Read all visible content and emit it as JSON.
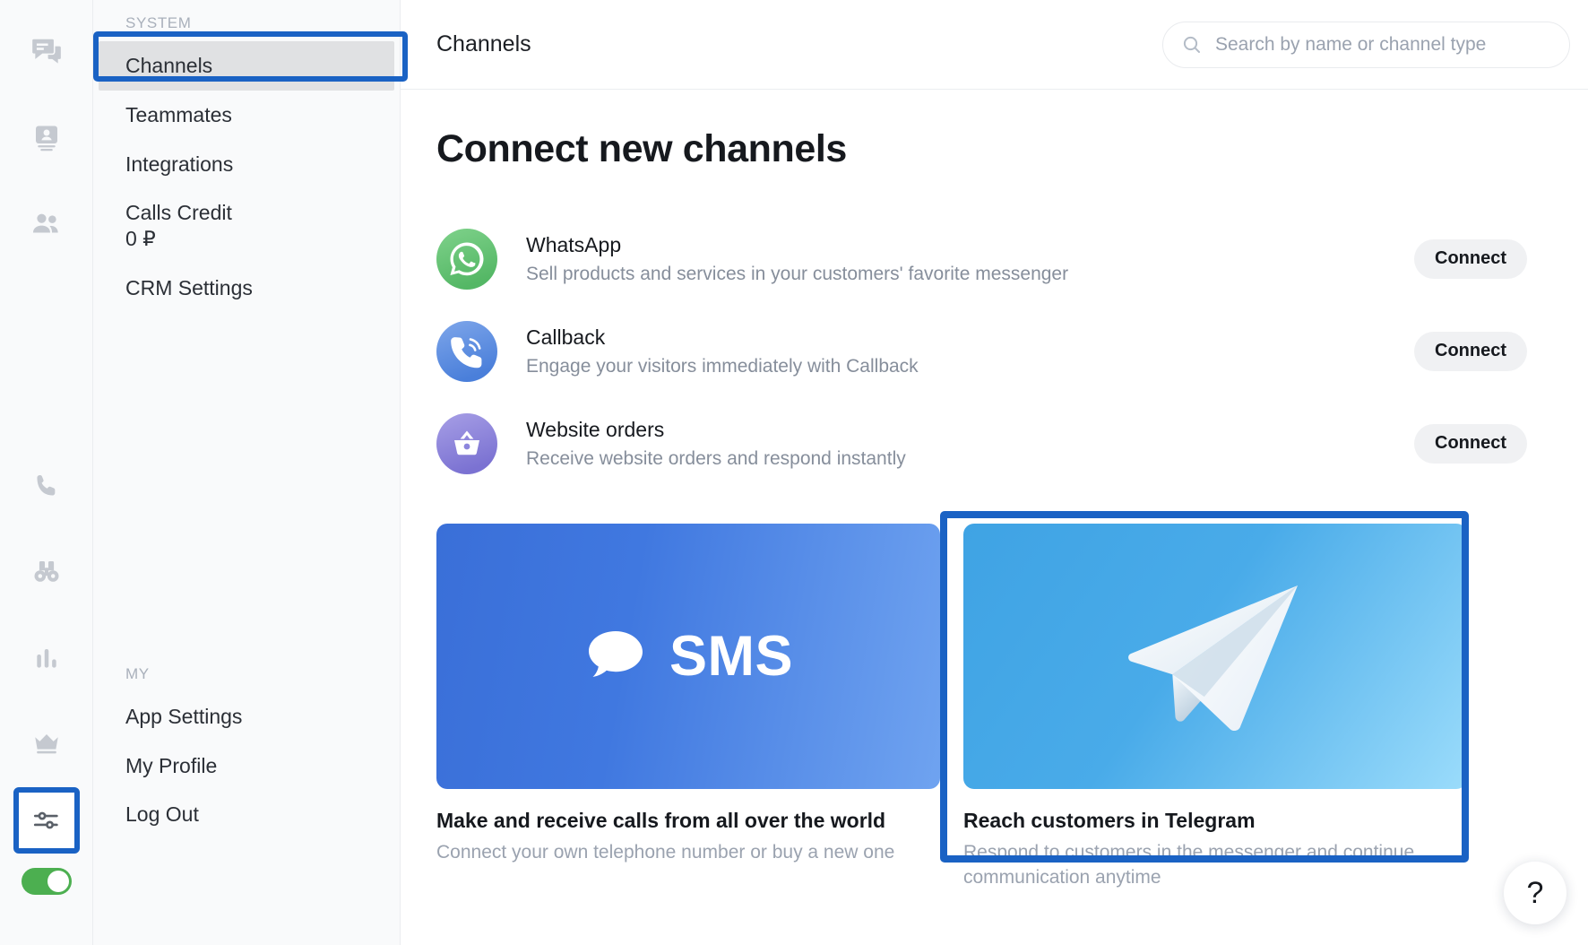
{
  "rail": {
    "icons": [
      {
        "name": "chats-icon"
      },
      {
        "name": "contact-card-icon"
      },
      {
        "name": "people-icon"
      },
      {
        "name": "phone-icon"
      },
      {
        "name": "binoculars-icon"
      },
      {
        "name": "bar-chart-icon"
      },
      {
        "name": "crown-icon"
      },
      {
        "name": "settings-sliders-icon"
      }
    ],
    "toggle": {
      "name": "online-status-toggle",
      "state": "on",
      "color": "#4caf50"
    }
  },
  "sidebar": {
    "system_label": "SYSTEM",
    "my_label": "MY",
    "system_items": [
      {
        "label": "Channels",
        "selected": true
      },
      {
        "label": "Teammates",
        "selected": false
      },
      {
        "label": "Integrations",
        "selected": false
      },
      {
        "label": "Calls Credit",
        "sub": "0 ₽",
        "selected": false
      },
      {
        "label": "CRM Settings",
        "selected": false
      }
    ],
    "my_items": [
      {
        "label": "App Settings"
      },
      {
        "label": "My Profile"
      },
      {
        "label": "Log Out"
      }
    ]
  },
  "header": {
    "title": "Channels",
    "search_placeholder": "Search by name or channel type",
    "search_value": ""
  },
  "main": {
    "heading": "Connect new channels",
    "connect_label": "Connect",
    "channels": [
      {
        "name": "WhatsApp",
        "desc": "Sell products and services in your customers' favorite messenger",
        "icon": "whatsapp-icon",
        "color": "#63c372"
      },
      {
        "name": "Callback",
        "desc": "Engage your visitors immediately with Callback",
        "icon": "callback-phone-icon",
        "color": "#5f8fe0"
      },
      {
        "name": "Website orders",
        "desc": "Receive website orders and respond instantly",
        "icon": "shopping-basket-icon",
        "color": "#8d86dd"
      }
    ],
    "cards": [
      {
        "banner_label": "SMS",
        "title": "Make and receive calls from all over the world",
        "sub": "Connect your own telephone number or buy a new one",
        "icon": "speech-bubble-icon"
      },
      {
        "banner_label": "",
        "title": "Reach customers in Telegram",
        "sub": "Respond to customers in the messenger and continue communication anytime",
        "icon": "telegram-plane-icon"
      }
    ]
  },
  "help": {
    "label": "?",
    "name": "help-button"
  },
  "annotations": {
    "color": "#1a62c4"
  }
}
